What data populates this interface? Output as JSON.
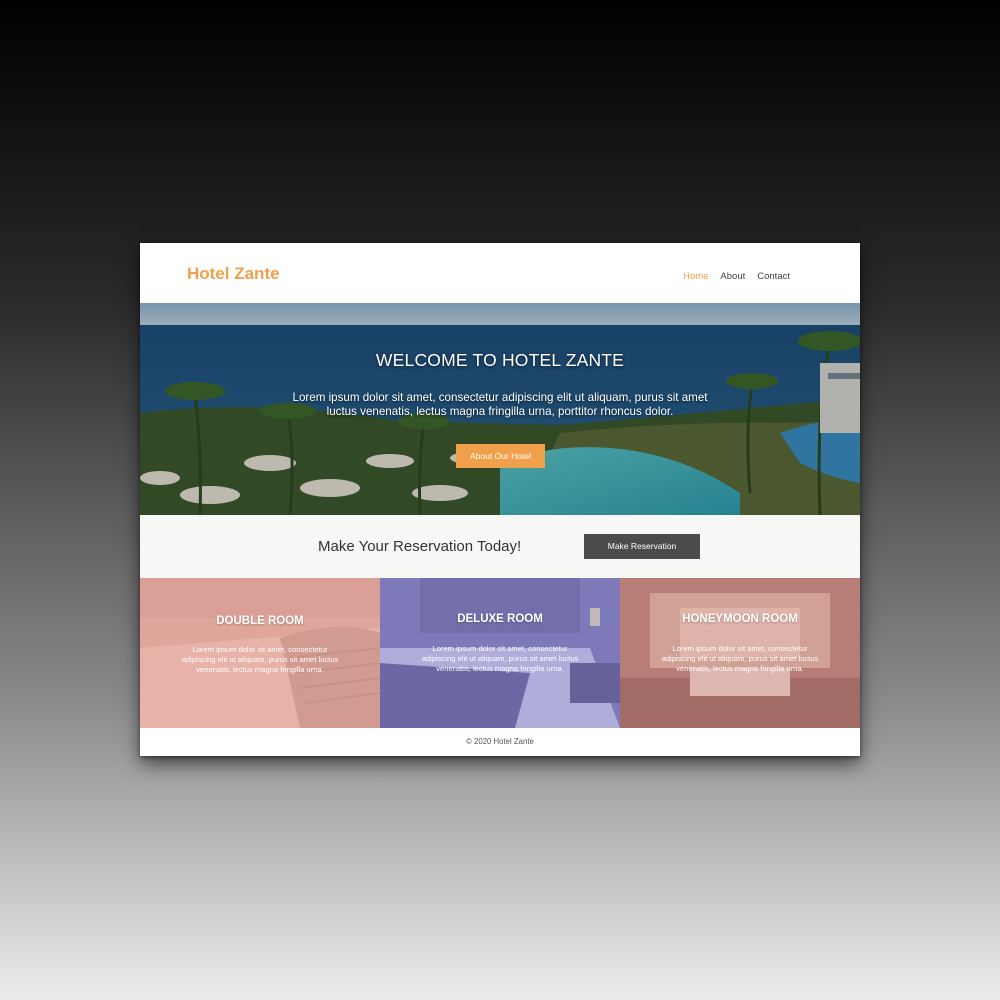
{
  "site": {
    "logo": "Hotel Zante",
    "nav": {
      "home": "Home",
      "about": "About",
      "contact": "Contact"
    },
    "accent_color": "#f0a04b"
  },
  "hero": {
    "title": "WELCOME TO HOTEL ZANTE",
    "text": "Lorem ipsum dolor sit amet, consectetur adipiscing elit ut aliquam, purus sit amet luctus venenatis, lectus magna fringilla urna, porttitor rhoncus dolor.",
    "button": "About Our Hotel"
  },
  "reservation": {
    "text": "Make Your Reservation Today!",
    "button": "Make Reservation"
  },
  "rooms": [
    {
      "title": "DOUBLE ROOM",
      "text": "Lorem ipsum dolor sit amet, consectetur adipiscing elit ut aliquam, purus sit amet luctus venenatis, lectus magna fringilla urna.",
      "overlay": "#e8a59a"
    },
    {
      "title": "DELUXE ROOM",
      "text": "Lorem ipsum dolor sit amet, consectetur adipiscing elit ut aliquam, purus sit amet luctus venenatis, lectus magna fringilla urna.",
      "overlay": "#8e88c8"
    },
    {
      "title": "HONEYMOON ROOM",
      "text": "Lorem ipsum dolor sit amet, consectetur adipiscing elit ut aliquam, purus sit amet luctus venenatis, lectus magna fringilla urna.",
      "overlay": "#c98a84"
    }
  ],
  "footer": {
    "copyright": "© 2020 Hotel Zante"
  }
}
